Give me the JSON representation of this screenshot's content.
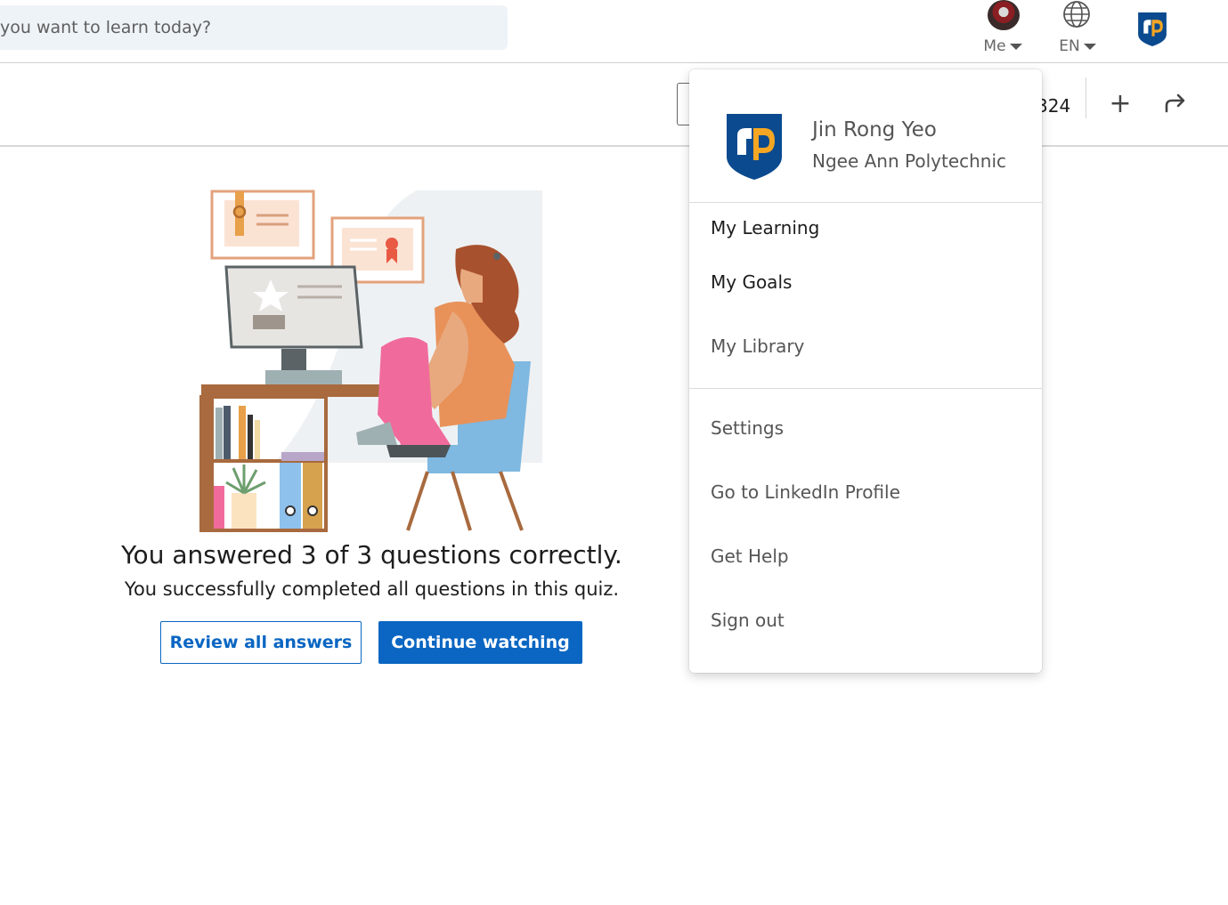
{
  "search": {
    "placeholder_visible": "you want to learn today?"
  },
  "header": {
    "me_label": "Me",
    "lang_label": "EN"
  },
  "toolbar": {
    "count_partial": "324"
  },
  "quiz_result": {
    "title": "You answered 3 of 3 questions correctly.",
    "subtitle": "You successfully completed all questions in this quiz.",
    "review_button": "Review all answers",
    "continue_button": "Continue watching"
  },
  "dropdown": {
    "profile": {
      "name": "Jin Rong Yeo",
      "organization": "Ngee Ann Polytechnic"
    },
    "menu_primary": [
      {
        "label": "My Learning"
      },
      {
        "label": "My Goals"
      },
      {
        "label": "My Library"
      }
    ],
    "menu_secondary": [
      {
        "label": "Settings"
      },
      {
        "label": "Go to LinkedIn Profile"
      },
      {
        "label": "Get Help"
      },
      {
        "label": "Sign out"
      }
    ]
  },
  "colors": {
    "primary": "#0a66c2",
    "org_logo_blue": "#0b4a8f",
    "org_logo_orange": "#f5a623"
  },
  "icons": [
    "avatar",
    "globe-icon",
    "caret-down-icon",
    "org-logo",
    "plus-icon",
    "share-icon"
  ]
}
